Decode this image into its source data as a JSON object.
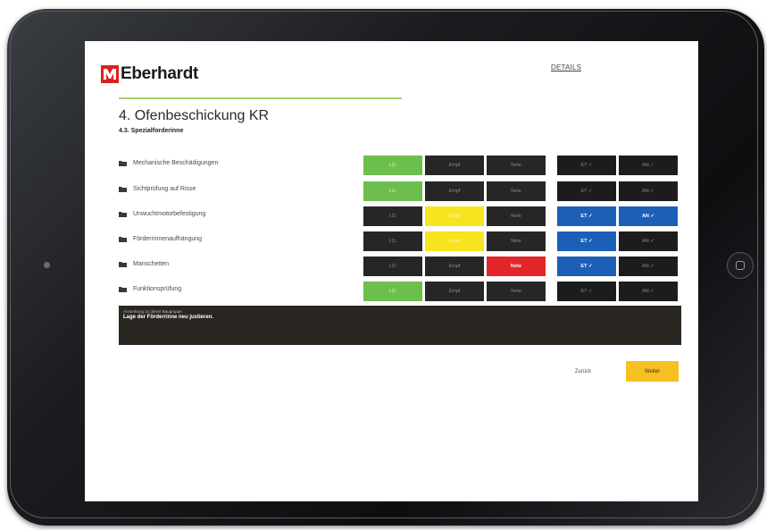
{
  "brand": {
    "name": "Eberhardt",
    "logo_color": "#d8231f"
  },
  "header": {
    "details_link": "DETAILS"
  },
  "page": {
    "title": "4. Ofenbeschickung KR",
    "subtitle": "4.3. Spezialforderinne"
  },
  "rows": [
    {
      "label": "Mechanische Beschädigungen",
      "io": "I.O.",
      "empf": "Empf",
      "note": "Note",
      "et": "ET ✓",
      "an": "AN ✓"
    },
    {
      "label": "Sichtprüfung auf Risse",
      "io": "I.O.",
      "empf": "Empf",
      "note": "Note",
      "et": "ET ✓",
      "an": "AN ✓"
    },
    {
      "label": "Unwuchtmotorbefestigung",
      "io": "I.O.",
      "empf": "Empf",
      "note": "Note",
      "et": "ET ✓",
      "an": "AN ✓"
    },
    {
      "label": "Förderrinnenaufhängung",
      "io": "I.O.",
      "empf": "Empf",
      "note": "Note",
      "et": "ET ✓",
      "an": "AN ✓"
    },
    {
      "label": "Manschetten",
      "io": "I.O.",
      "empf": "Empf",
      "note": "Note",
      "et": "ET ✓",
      "an": "AN ✓"
    },
    {
      "label": "Funktionsprüfung",
      "io": "I.O.",
      "empf": "Empf",
      "note": "Note",
      "et": "ET ✓",
      "an": "AN ✓"
    }
  ],
  "comment": {
    "label": "Anmerkung zu dieser Baugruppe",
    "text": "Lage der Förderrinne neu justieren."
  },
  "footer": {
    "back_label": "Zurück",
    "next_label": "Weiter"
  },
  "colors": {
    "green": "#6cbf4c",
    "yellow": "#f6e51e",
    "red": "#e3262a",
    "blue": "#1c5fb7",
    "dark": "#262626",
    "accent_line": "#a7d16b",
    "next_button": "#f7c021"
  }
}
